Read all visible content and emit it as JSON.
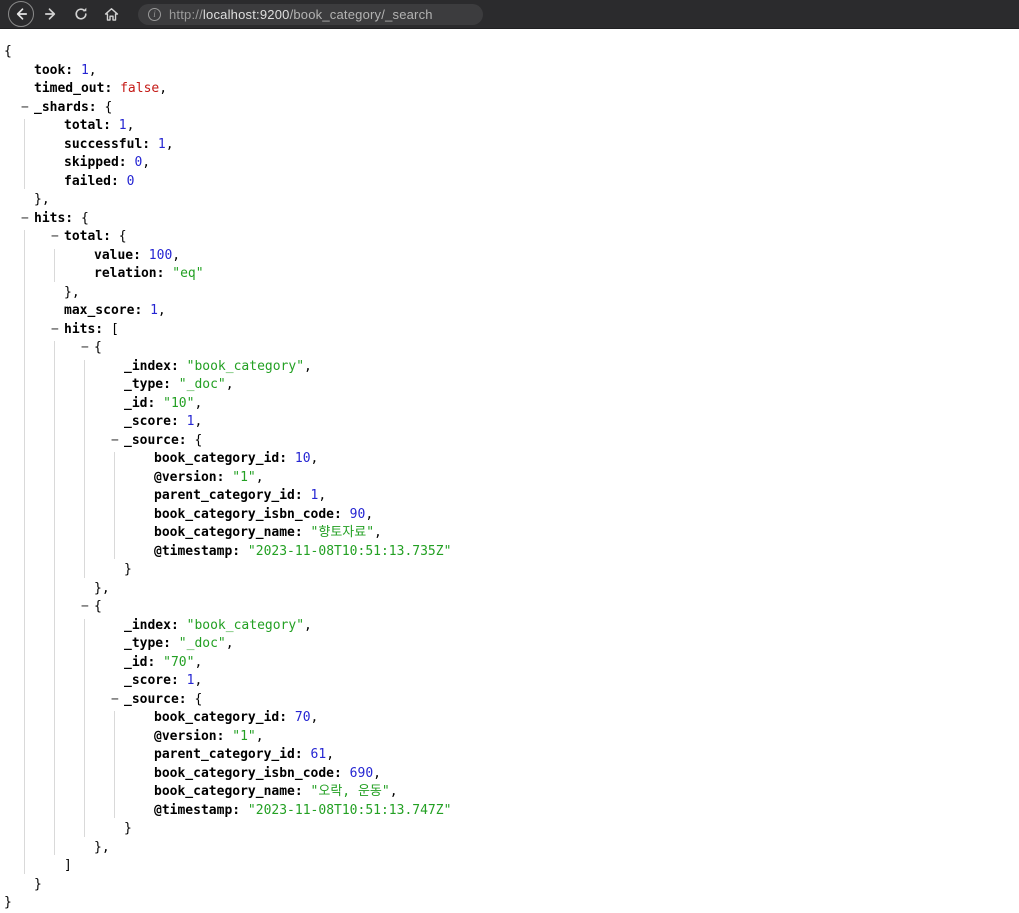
{
  "browser": {
    "toolbar_icons": {
      "back": "back-arrow-icon",
      "forward": "forward-arrow-icon",
      "reload": "reload-icon",
      "home": "home-icon",
      "info": "info-icon"
    },
    "url": {
      "scheme": "http://",
      "host": "localhost:9200",
      "path": "/book_category/_search"
    }
  },
  "colors": {
    "toolbar_bg": "#2b2b2d",
    "urlbar_bg": "#3c3c3e",
    "json_key": "#000000",
    "json_number": "#2525d2",
    "json_string": "#23a023",
    "json_boolean": "#c41a16",
    "indent_guide": "#d9d9d9"
  },
  "response": {
    "took": 1,
    "timed_out": false,
    "_shards": {
      "total": 1,
      "successful": 1,
      "skipped": 0,
      "failed": 0
    },
    "hits": {
      "total": {
        "value": 100,
        "relation": "eq"
      },
      "max_score": 1,
      "hits": [
        {
          "_index": "book_category",
          "_type": "_doc",
          "_id": "10",
          "_score": 1,
          "_source": {
            "book_category_id": 10,
            "@version": "1",
            "parent_category_id": 1,
            "book_category_isbn_code": 90,
            "book_category_name": "향토자료",
            "@timestamp": "2023-11-08T10:51:13.735Z"
          }
        },
        {
          "_index": "book_category",
          "_type": "_doc",
          "_id": "70",
          "_score": 1,
          "_source": {
            "book_category_id": 70,
            "@version": "1",
            "parent_category_id": 61,
            "book_category_isbn_code": 690,
            "book_category_name": "오락, 운동",
            "@timestamp": "2023-11-08T10:51:13.747Z"
          }
        }
      ]
    }
  }
}
